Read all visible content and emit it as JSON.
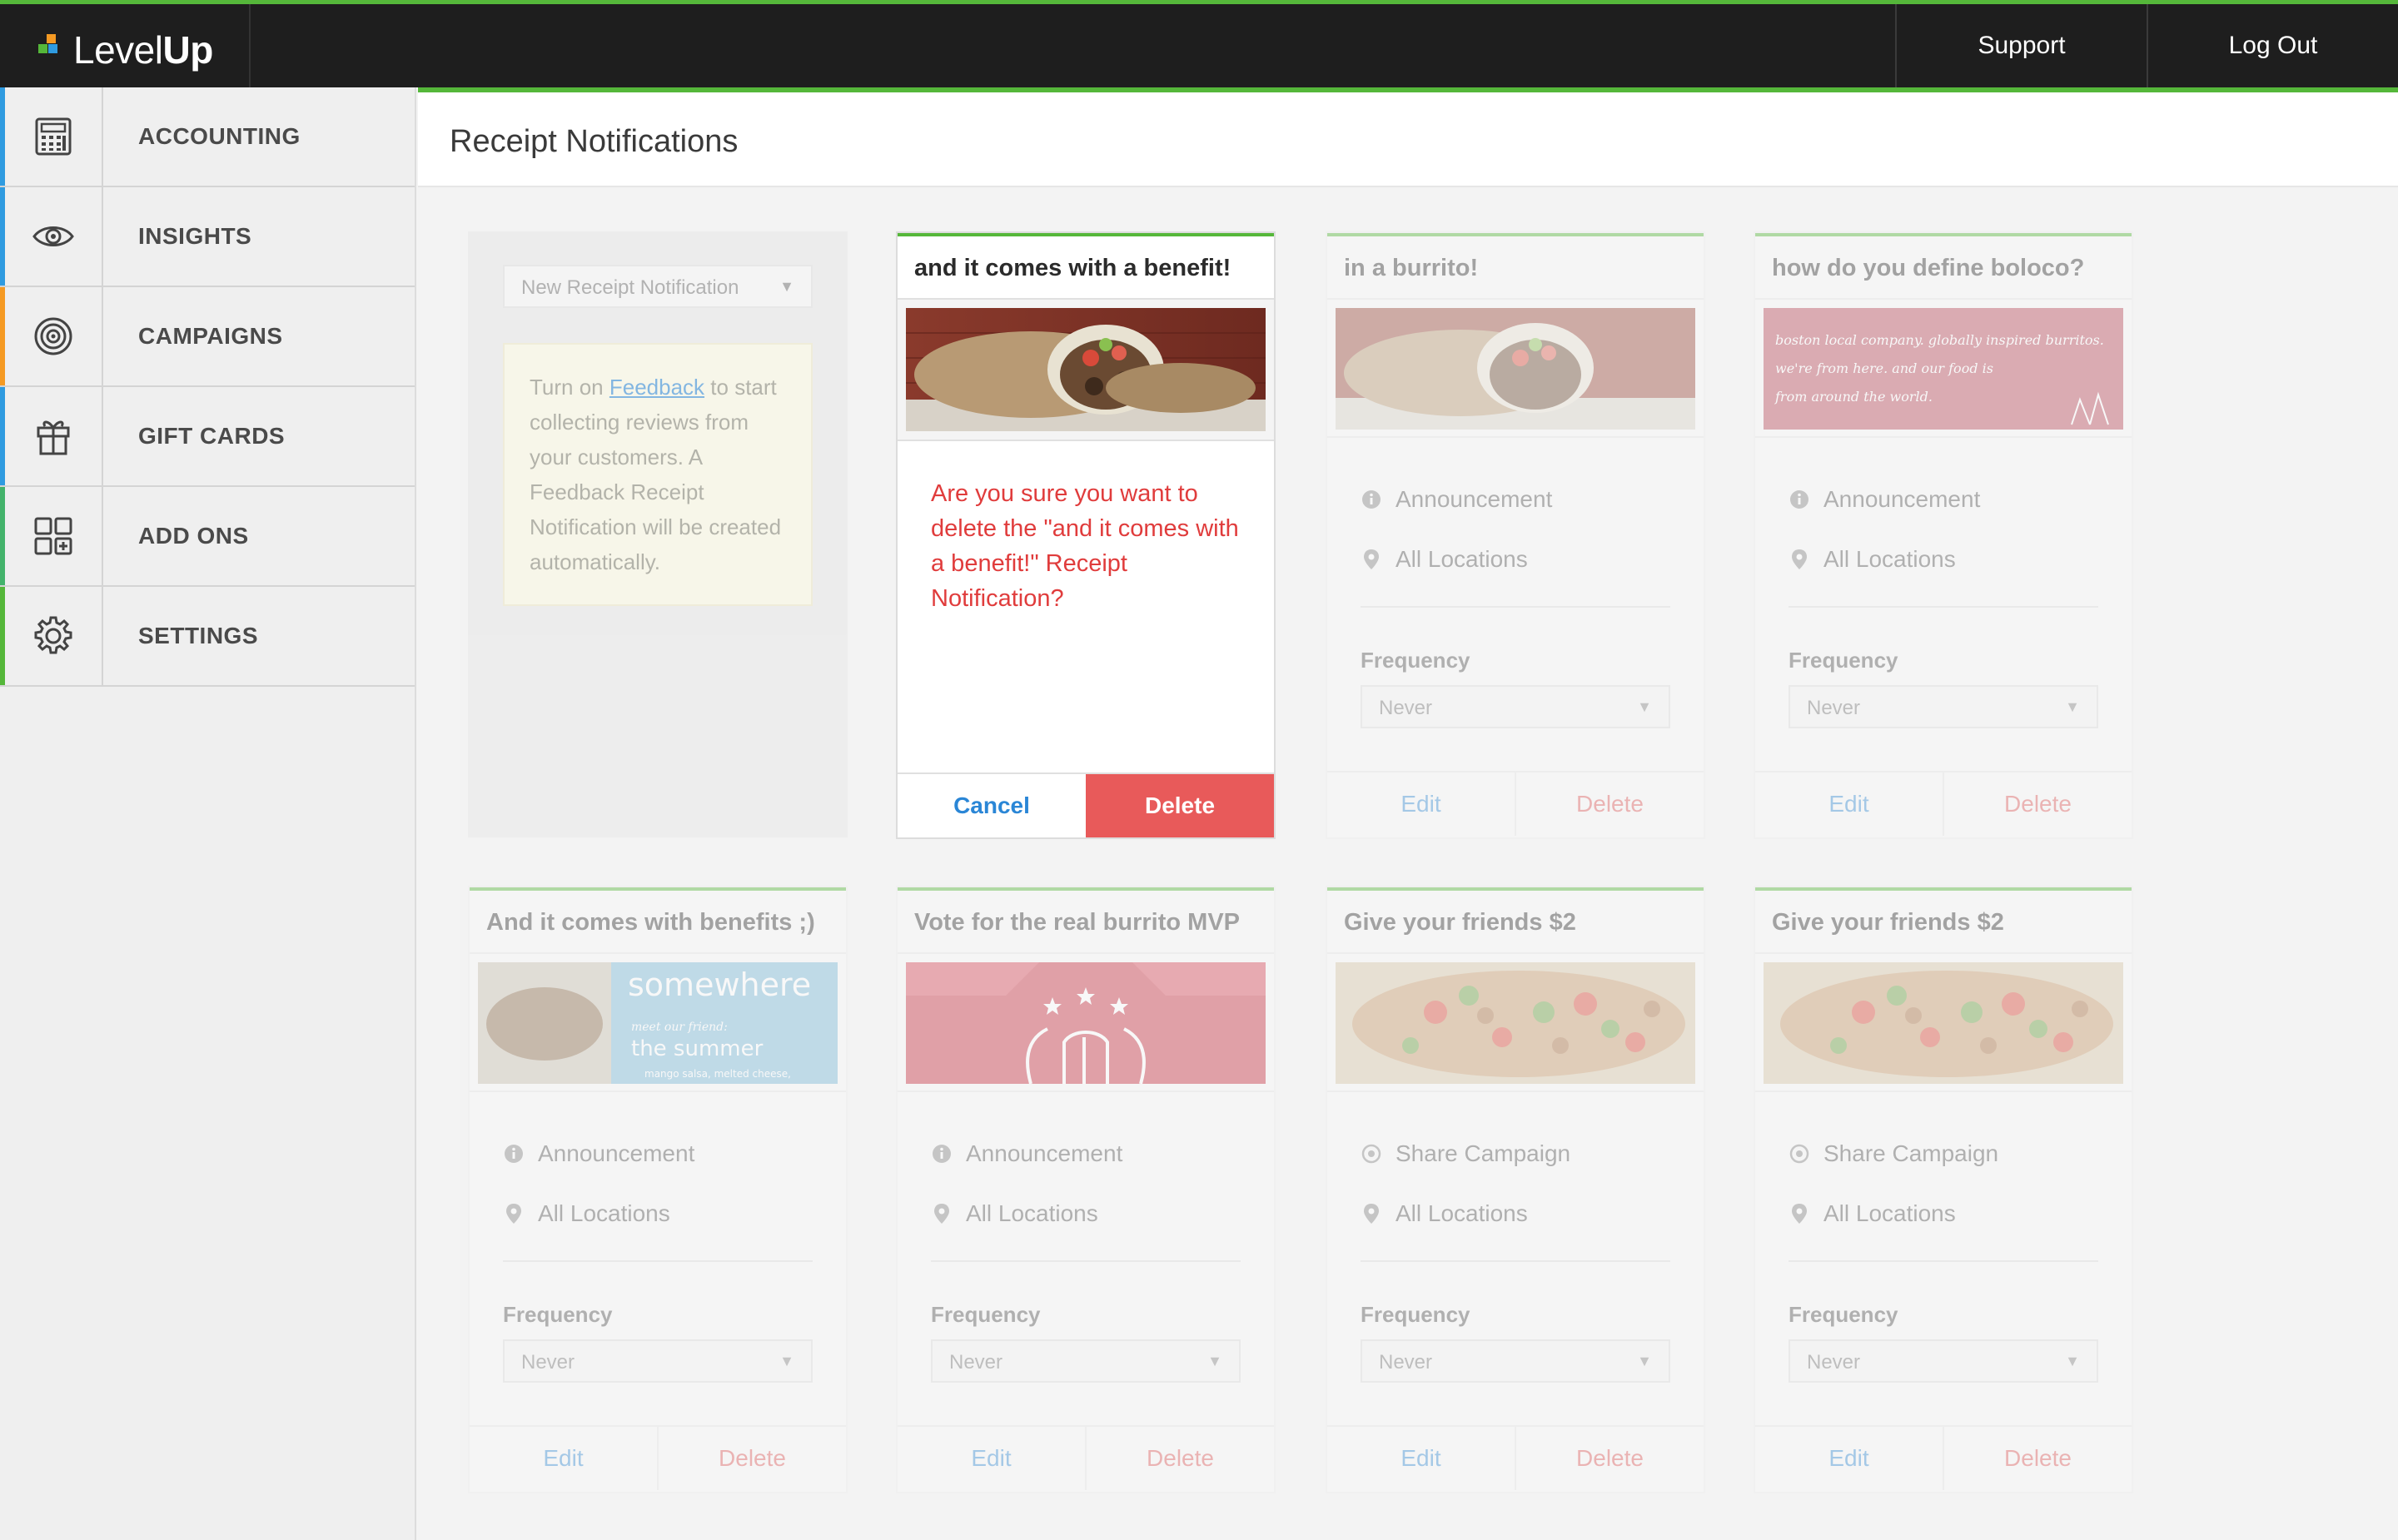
{
  "topbar": {
    "logo_prefix": "Level",
    "logo_bold": "Up",
    "support": "Support",
    "logout": "Log Out"
  },
  "sidebar": {
    "items": [
      {
        "label": "ACCOUNTING",
        "icon": "calculator-icon",
        "accent": "#2f9be0"
      },
      {
        "label": "INSIGHTS",
        "icon": "eye-icon",
        "accent": "#2f9be0"
      },
      {
        "label": "CAMPAIGNS",
        "icon": "target-icon",
        "accent": "#f59a23"
      },
      {
        "label": "GIFT CARDS",
        "icon": "gift-icon",
        "accent": "#2f9be0"
      },
      {
        "label": "ADD ONS",
        "icon": "grid-plus-icon",
        "accent": "#43b36b"
      },
      {
        "label": "SETTINGS",
        "icon": "gear-icon",
        "accent": "#55b73a"
      }
    ]
  },
  "main": {
    "title": "Receipt Notifications"
  },
  "new_panel": {
    "select_label": "New Receipt Notification",
    "feedback_before": "Turn on ",
    "feedback_link": "Feedback",
    "feedback_after": " to start collecting reviews from your customers. A Feedback Receipt Notification will be created automatically."
  },
  "confirm": {
    "title": "and it comes with a benefit!",
    "message": "Are you sure you want to delete the \"and it comes with a benefit!\" Receipt Notification?",
    "cancel": "Cancel",
    "delete": "Delete"
  },
  "card_labels": {
    "frequency": "Frequency",
    "edit": "Edit",
    "delete": "Delete"
  },
  "cards": [
    {
      "title": "in a burrito!",
      "type": "Announcement",
      "type_icon": "info-icon",
      "locations": "All Locations",
      "frequency": "Never"
    },
    {
      "title": "how do you define boloco?",
      "type": "Announcement",
      "type_icon": "info-icon",
      "locations": "All Locations",
      "frequency": "Never",
      "image_text": [
        "boston local company. globally inspired burritos.",
        "we're from here. and our food is",
        "from around the world."
      ]
    },
    {
      "title": "And it comes with benefits ;)",
      "type": "Announcement",
      "type_icon": "info-icon",
      "locations": "All Locations",
      "frequency": "Never",
      "image_text": [
        "somewhere",
        "meet our friend:",
        "the summer",
        "mango salsa, melted cheese,"
      ]
    },
    {
      "title": "Vote for the real burrito MVP",
      "type": "Announcement",
      "type_icon": "info-icon",
      "locations": "All Locations",
      "frequency": "Never"
    },
    {
      "title": "Give your friends $2",
      "type": "Share Campaign",
      "type_icon": "share-icon",
      "locations": "All Locations",
      "frequency": "Never"
    },
    {
      "title": "Give your friends $2",
      "type": "Share Campaign",
      "type_icon": "share-icon",
      "locations": "All Locations",
      "frequency": "Never"
    }
  ],
  "colors": {
    "brand_green": "#55b73a",
    "delete_red": "#e85a5a",
    "link_blue": "#2a86d6"
  }
}
